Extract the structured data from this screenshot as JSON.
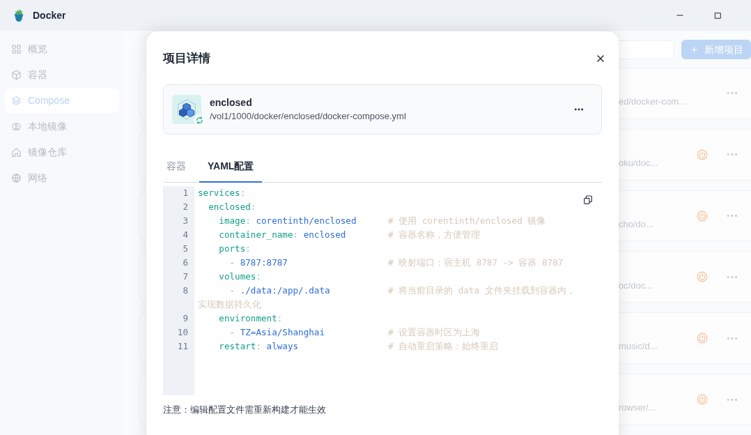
{
  "window": {
    "title": "Docker"
  },
  "sidebar": {
    "items": [
      {
        "label": "概览",
        "selected": false
      },
      {
        "label": "容器",
        "selected": false
      },
      {
        "label": "Compose",
        "selected": true
      },
      {
        "label": "本地镜像",
        "selected": false
      },
      {
        "label": "镜像仓库",
        "selected": false
      },
      {
        "label": "网络",
        "selected": false
      }
    ]
  },
  "main": {
    "add_button": "新增项目",
    "projects": [
      {
        "path": "ed/docker-com...",
        "power_button": false
      },
      {
        "path": "oku/doc...",
        "power_button": true
      },
      {
        "path": "cho/do...",
        "power_button": true
      },
      {
        "path": "oc/doc...",
        "power_button": true
      },
      {
        "path": "music/d...",
        "power_button": true
      },
      {
        "path": "rowser/...",
        "power_button": true
      }
    ]
  },
  "dialog": {
    "title": "项目详情",
    "project": {
      "name": "enclosed",
      "path": "/vol1/1000/docker/enclosed/docker-compose.yml"
    },
    "tabs": [
      {
        "label": "容器",
        "selected": false
      },
      {
        "label": "YAML配置",
        "selected": true
      }
    ],
    "code_lines": [
      {
        "number": "1",
        "tokens": [
          {
            "kind": "key",
            "text": "services"
          },
          {
            "kind": "punct",
            "text": ":"
          }
        ]
      },
      {
        "number": "2",
        "tokens": [
          {
            "kind": "key",
            "text": "  enclosed"
          },
          {
            "kind": "punct",
            "text": ":"
          }
        ]
      },
      {
        "number": "3",
        "tokens": [
          {
            "kind": "key",
            "text": "    image"
          },
          {
            "kind": "punct",
            "text": ": "
          },
          {
            "kind": "value",
            "text": "corentinth/enclosed"
          }
        ],
        "comment": "# 使用 corentinth/enclosed 镜像"
      },
      {
        "number": "4",
        "tokens": [
          {
            "kind": "key",
            "text": "    container_name"
          },
          {
            "kind": "punct",
            "text": ": "
          },
          {
            "kind": "value",
            "text": "enclosed"
          }
        ],
        "comment": "# 容器名称，方便管理"
      },
      {
        "number": "5",
        "tokens": [
          {
            "kind": "key",
            "text": "    ports"
          },
          {
            "kind": "punct",
            "text": ":"
          }
        ]
      },
      {
        "number": "6",
        "tokens": [
          {
            "kind": "dash",
            "text": "      - "
          },
          {
            "kind": "value",
            "text": "8787:8787"
          }
        ],
        "comment": "# 映射端口：宿主机 8787 -> 容器 8787"
      },
      {
        "number": "7",
        "tokens": [
          {
            "kind": "key",
            "text": "    volumes"
          },
          {
            "kind": "punct",
            "text": ":"
          }
        ]
      },
      {
        "number": "8",
        "tokens": [
          {
            "kind": "dash",
            "text": "      - "
          },
          {
            "kind": "value",
            "text": "./data:/app/.data"
          }
        ],
        "comment": "# 将当前目录的 data 文件夹挂载到容器内，实现数据持久化"
      },
      {
        "number": "9",
        "tokens": [
          {
            "kind": "key",
            "text": "    environment"
          },
          {
            "kind": "punct",
            "text": ":"
          }
        ]
      },
      {
        "number": "10",
        "tokens": [
          {
            "kind": "dash",
            "text": "      - "
          },
          {
            "kind": "value",
            "text": "TZ=Asia/Shanghai"
          }
        ],
        "comment": "# 设置容器时区为上海"
      },
      {
        "number": "11",
        "tokens": [
          {
            "kind": "key",
            "text": "    restart"
          },
          {
            "kind": "punct",
            "text": ": "
          },
          {
            "kind": "value",
            "text": "always"
          }
        ],
        "comment": "# 自动重启策略：始终重启"
      }
    ],
    "note": "注意：编辑配置文件需重新构建才能生效"
  }
}
